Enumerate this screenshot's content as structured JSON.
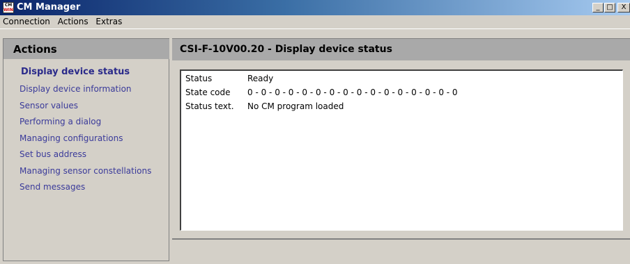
{
  "window": {
    "title": "CM Manager",
    "icon_name": "cmwin-app-icon",
    "icon_text_top": "CM",
    "icon_text_bottom": "WIN",
    "controls": {
      "minimize": "_",
      "maximize": "□",
      "close": "X"
    }
  },
  "menu": [
    "Connection",
    "Actions",
    "Extras"
  ],
  "sidebar": {
    "header": "Actions",
    "items": [
      {
        "label": "Display device status",
        "selected": true
      },
      {
        "label": "Display device information",
        "selected": false
      },
      {
        "label": "Sensor values",
        "selected": false
      },
      {
        "label": "Performing a dialog",
        "selected": false
      },
      {
        "label": "Managing configurations",
        "selected": false
      },
      {
        "label": "Set bus address",
        "selected": false
      },
      {
        "label": "Managing sensor constellations",
        "selected": false
      },
      {
        "label": "Send messages",
        "selected": false
      }
    ]
  },
  "main": {
    "title": "CSI-F-10V00.20 - Display device status",
    "rows": [
      {
        "key": "Status",
        "value": "Ready"
      },
      {
        "key": "State code",
        "value": "0 - 0 - 0 - 0 - 0 - 0 - 0 - 0 - 0 - 0 - 0 - 0 - 0 - 0 - 0 - 0"
      },
      {
        "key": "Status text.",
        "value": "No CM program loaded"
      }
    ]
  },
  "colors": {
    "titlebar_start": "#0a246a",
    "titlebar_end": "#a6caf0",
    "link": "#3a3a9a",
    "panel_header": "#a9a9a9",
    "window_bg": "#d4d0c8"
  }
}
